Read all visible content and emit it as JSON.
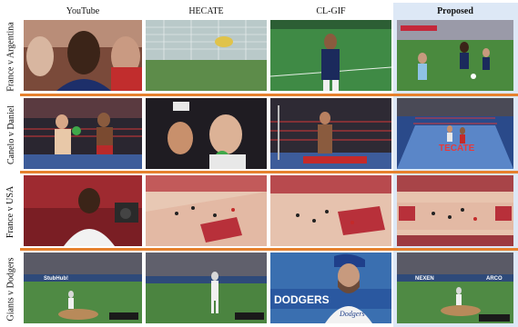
{
  "columns": [
    "YouTube",
    "HECATE",
    "CL-GIF",
    "Proposed"
  ],
  "rows": [
    {
      "label": "France v Argentina"
    },
    {
      "label": "Canelo v Daniel"
    },
    {
      "label": "France v USA"
    },
    {
      "label": "Giants v Dodgers"
    }
  ],
  "overlays": {
    "fifa_tv": "FIFA TV",
    "tecate": "TECATE",
    "dodgers": "DODGERS",
    "jersey_name": "Dodgers",
    "stubhub": "StubHub!",
    "arco": "ARCO",
    "nexen": "NEXEN"
  },
  "colors": {
    "proposed_bg": "#dde8f6",
    "separator": "#e6812e"
  }
}
